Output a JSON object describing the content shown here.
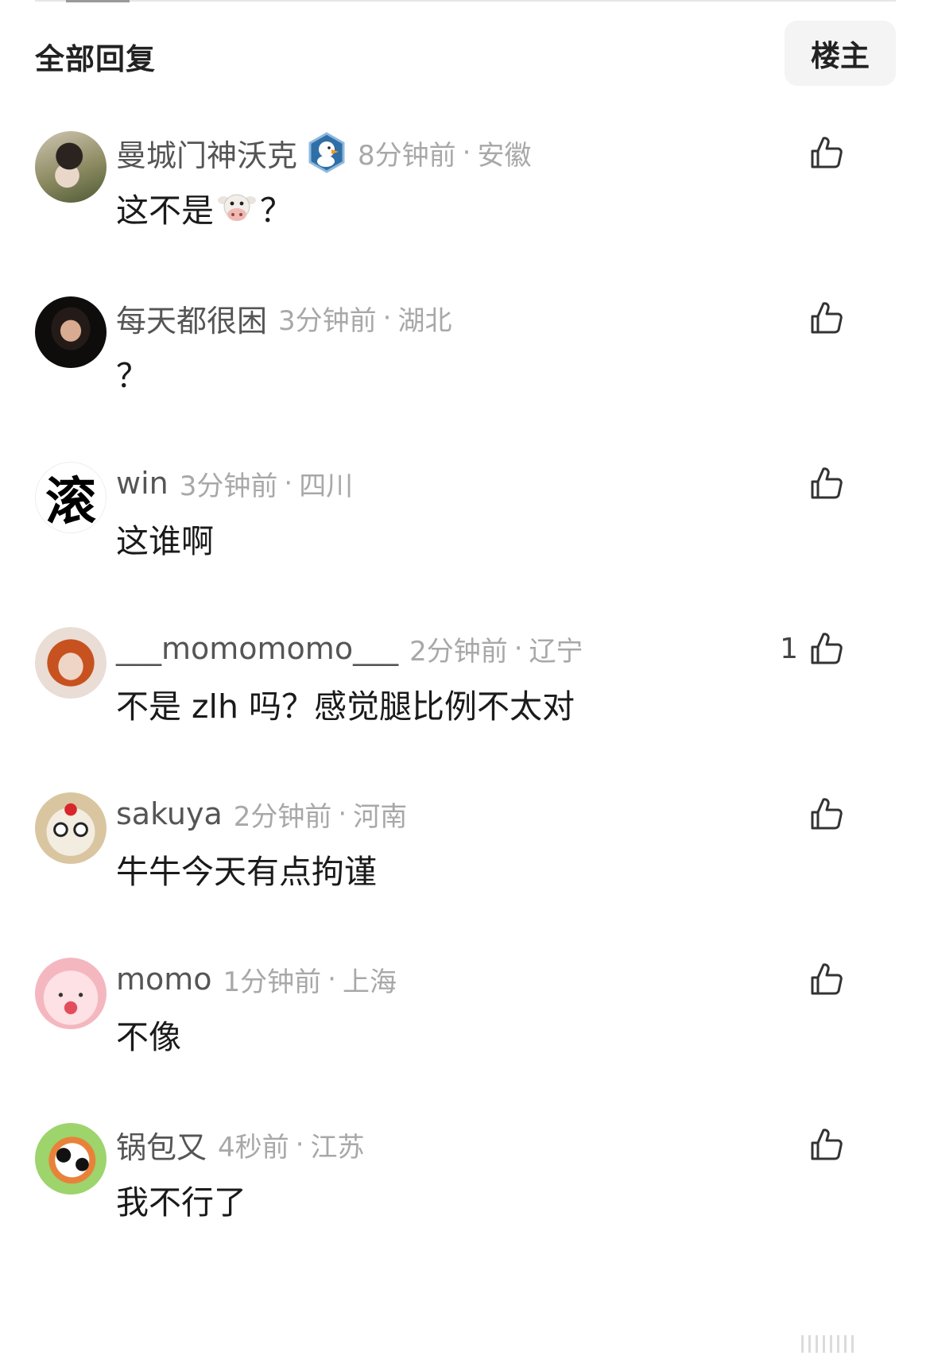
{
  "header": {
    "title": "全部回复",
    "op_label": "楼主"
  },
  "comments": [
    {
      "username": "曼城门神沃克",
      "time": "8分钟前",
      "location": "安徽",
      "text_before": "这不是",
      "emoji": "cow-face",
      "text_after": "？",
      "likes": ""
    },
    {
      "username": "每天都很困",
      "time": "3分钟前",
      "location": "湖北",
      "text_before": "？",
      "text_after": "",
      "likes": ""
    },
    {
      "username": "win",
      "time": "3分钟前",
      "location": "四川",
      "text_before": "这谁啊",
      "text_after": "",
      "likes": "",
      "avatar_text": "滚"
    },
    {
      "username": "___momomomo___",
      "time": "2分钟前",
      "location": "辽宁",
      "text_before": "不是 zlh 吗？感觉腿比例不太对",
      "text_after": "",
      "likes": "1"
    },
    {
      "username": "sakuya",
      "time": "2分钟前",
      "location": "河南",
      "text_before": "牛牛今天有点拘谨",
      "text_after": "",
      "likes": ""
    },
    {
      "username": "momo",
      "time": "1分钟前",
      "location": "上海",
      "text_before": "不像",
      "text_after": "",
      "likes": ""
    },
    {
      "username": "锅包又",
      "time": "4秒前",
      "location": "江苏",
      "text_before": "我不行了",
      "text_after": "",
      "likes": ""
    }
  ],
  "icons": {
    "like": "thumbs-up-icon",
    "badge": "duck-badge-icon",
    "emoji": "cow-face-emoji"
  }
}
